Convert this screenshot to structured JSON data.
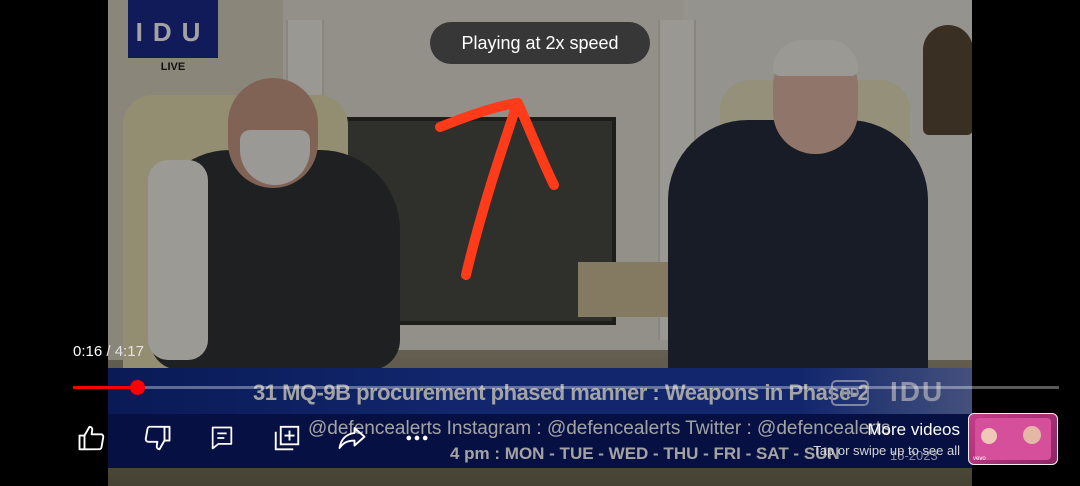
{
  "video": {
    "channel_logo": {
      "text": "IDU",
      "live": "LIVE"
    },
    "ticker": {
      "headline": "31 MQ-9B procurement phased manner : Weapons in Phase-2",
      "badge": "HD",
      "brand": "IDU",
      "social": "@defencealerts     Instagram : @defencealerts     Twitter :  @defencealerts",
      "schedule": "4 pm : MON - TUE - WED - THU - FRI - SAT - SUN",
      "date": "15-2023"
    }
  },
  "toast": {
    "text": "Playing at 2x speed"
  },
  "player": {
    "current_time": "0:16",
    "separator": " / ",
    "total_time": "4:17",
    "progress": 0.065
  },
  "actions": [
    {
      "name": "like",
      "icon": "thumbs-up-icon"
    },
    {
      "name": "dislike",
      "icon": "thumbs-down-icon"
    },
    {
      "name": "comments",
      "icon": "comment-icon"
    },
    {
      "name": "save",
      "icon": "add-to-playlist-icon"
    },
    {
      "name": "share",
      "icon": "share-icon"
    },
    {
      "name": "more",
      "icon": "more-dots-icon"
    }
  ],
  "more_videos": {
    "title": "More videos",
    "subtitle": "Tap or swipe up to see all",
    "thumb_label": "vevo"
  },
  "colors": {
    "progress": "#ff0000",
    "annotation": "#ff3b1a",
    "ticker_blue": "#1b3caa"
  }
}
